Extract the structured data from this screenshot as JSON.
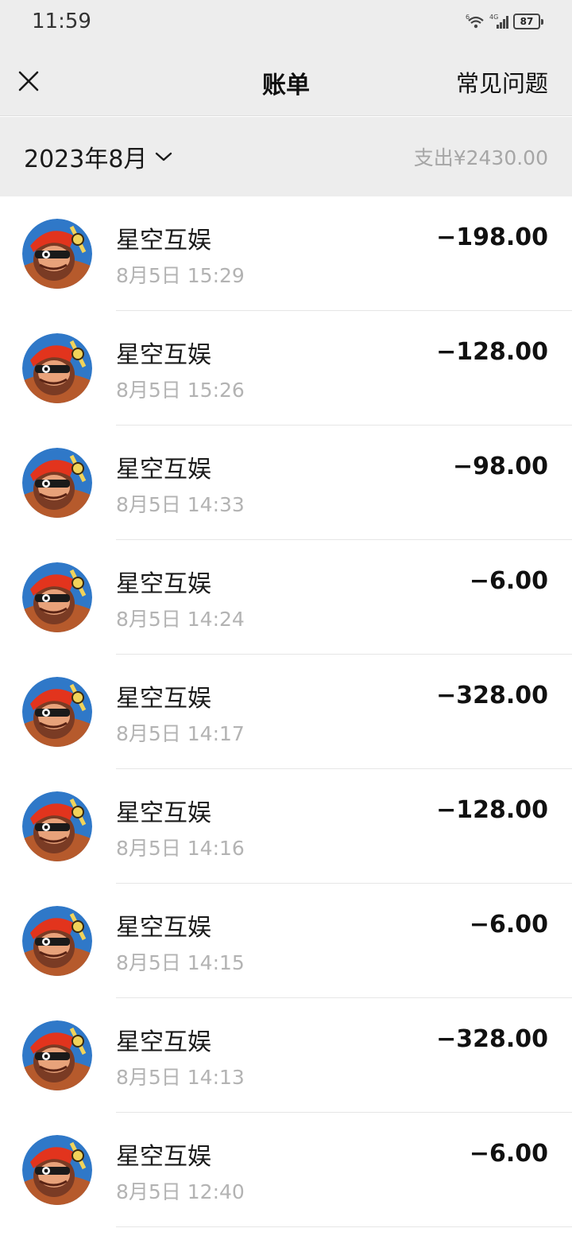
{
  "status_bar": {
    "time": "11:59",
    "battery": "87"
  },
  "nav": {
    "title": "账单",
    "faq": "常见问题"
  },
  "filter": {
    "month": "2023年8月",
    "expense_total": "支出¥2430.00"
  },
  "transactions": [
    {
      "merchant": "星空互娱",
      "time": "8月5日 15:29",
      "amount": "−198.00"
    },
    {
      "merchant": "星空互娱",
      "time": "8月5日 15:26",
      "amount": "−128.00"
    },
    {
      "merchant": "星空互娱",
      "time": "8月5日 14:33",
      "amount": "−98.00"
    },
    {
      "merchant": "星空互娱",
      "time": "8月5日 14:24",
      "amount": "−6.00"
    },
    {
      "merchant": "星空互娱",
      "time": "8月5日 14:17",
      "amount": "−328.00"
    },
    {
      "merchant": "星空互娱",
      "time": "8月5日 14:16",
      "amount": "−128.00"
    },
    {
      "merchant": "星空互娱",
      "time": "8月5日 14:15",
      "amount": "−6.00"
    },
    {
      "merchant": "星空互娱",
      "time": "8月5日 14:13",
      "amount": "−328.00"
    },
    {
      "merchant": "星空互娱",
      "time": "8月5日 12:40",
      "amount": "−6.00"
    }
  ],
  "icons": {
    "close": "close-icon",
    "chevron": "chevron-down-icon",
    "avatar": "game-character-avatar"
  },
  "colors": {
    "header_bg": "#ededed",
    "list_bg": "#ffffff",
    "amount_text": "#111111",
    "secondary_text": "#b3b3b3"
  }
}
